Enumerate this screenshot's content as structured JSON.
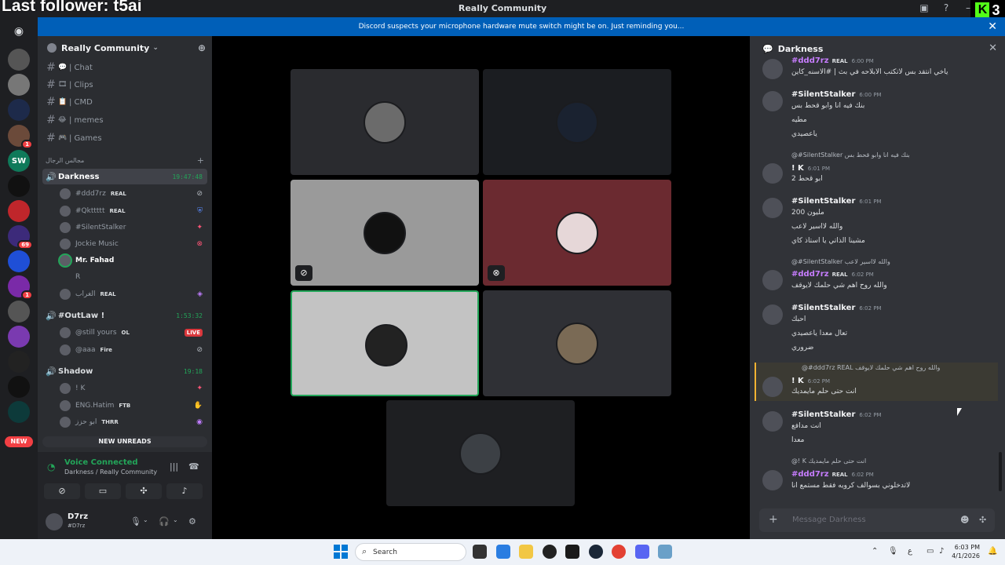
{
  "overlay": {
    "text": "Last follower: t5ai"
  },
  "window": {
    "title": "Really Community",
    "kick_count": "3"
  },
  "notice": {
    "text": "Discord suspects your microphone hardware mute switch might be on. Just reminding you..."
  },
  "server_rail": {
    "badges": [
      "1",
      "69",
      "1"
    ],
    "new_label": "NEW"
  },
  "server": {
    "name": "Really Community"
  },
  "text_channels": [
    {
      "emoji": "💬",
      "name": "| Chat"
    },
    {
      "emoji": "🎞",
      "name": "| Clips"
    },
    {
      "emoji": "📋",
      "name": "| CMD"
    },
    {
      "emoji": "😂",
      "name": "| memes"
    },
    {
      "emoji": "🎮",
      "name": "| Games"
    }
  ],
  "category": {
    "label": "مجالس الرجال"
  },
  "voice_channels": [
    {
      "name": "Darkness",
      "timer": "19:47:48",
      "users": [
        {
          "name": "#ddd7rz",
          "tag": "REAL"
        },
        {
          "name": "#Qkttttt",
          "tag": "REAL"
        },
        {
          "name": "#SilentStalker",
          "tag": ""
        },
        {
          "name": "Jockie Music",
          "tag": ""
        },
        {
          "name": "Mr. Fahad",
          "tag": ""
        },
        {
          "name": "R",
          "tag": ""
        },
        {
          "name": "الغراب",
          "tag": "REAL"
        }
      ]
    },
    {
      "name": "#OutLaw !",
      "timer": "1:53:32",
      "users": [
        {
          "name": "@still yours",
          "tag": "OL",
          "live": "LIVE"
        },
        {
          "name": "@aaa",
          "tag": "Fire"
        }
      ]
    },
    {
      "name": "Shadow",
      "timer": "19:18",
      "users": [
        {
          "name": "! K",
          "tag": ""
        },
        {
          "name": "ENG.Hatim",
          "tag": "FTB"
        },
        {
          "name": "ابو حزز",
          "tag": "THRR"
        }
      ]
    }
  ],
  "new_unreads": "NEW UNREADS",
  "voice_panel": {
    "status": "Voice Connected",
    "location": "Darkness / Really Community"
  },
  "user_panel": {
    "name": "D7rz",
    "handle": "#D7rz"
  },
  "chat": {
    "channel": "Darkness",
    "input_placeholder": "Message Darkness",
    "messages": [
      {
        "name": "#ddd7rz",
        "tag": "REAL",
        "time": "6:00 PM",
        "lines": [
          "ياخي انتقد بس لاتكتب الابلاحه في بث | #الاسنه_كاين"
        ]
      },
      {
        "name": "#SilentStalker",
        "tag": "",
        "time": "6:00 PM",
        "lines": [
          "بنك فيه انا وابو قحط بس",
          "مطيه",
          "ياعصيدي"
        ]
      },
      {
        "reply": "@#SilentStalker بنك فيه انا وابو قحط بس",
        "name": "! K",
        "tag": "",
        "time": "6:01 PM",
        "lines": [
          "ابو قحط 2"
        ]
      },
      {
        "name": "#SilentStalker",
        "tag": "",
        "time": "6:01 PM",
        "lines": [
          "200 مليون",
          "والله لااسير لاعب",
          "مشينا الذاتي يا استاذ كاي"
        ]
      },
      {
        "reply": "@#SilentStalker والله لااسير لاعب",
        "name": "#ddd7rz",
        "tag": "REAL",
        "time": "6:02 PM",
        "lines": [
          "والله روح اهم شي حلمك لايوقف"
        ]
      },
      {
        "name": "#SilentStalker",
        "tag": "",
        "time": "6:02 PM",
        "lines": [
          "احبك",
          "تعال معدا ياعصيدي",
          "ضروري"
        ]
      },
      {
        "reply": "@#ddd7rz REAL والله روح اهم شي حلمك لايوقف",
        "name": "! K",
        "tag": "",
        "time": "6:02 PM",
        "lines": [
          "انت حتى حلم مايمديك"
        ]
      },
      {
        "name": "#SilentStalker",
        "tag": "",
        "time": "6:02 PM",
        "lines": [
          "انت مدافع",
          "معدا"
        ]
      },
      {
        "reply": "@! K انت حتى حلم مايمديك",
        "name": "#ddd7rz",
        "tag": "REAL",
        "time": "6:02 PM",
        "lines": [
          "لاتدخلوني بسوالف كرويه فقط مستمع انا"
        ]
      }
    ]
  },
  "taskbar": {
    "search": "Search",
    "time": "6:03 PM",
    "date": "4/1/2026",
    "lang": "ع"
  },
  "colors": {
    "accent": "#23a559",
    "notice": "#005fb8",
    "live": "#da373c",
    "mention_highlight": "#f0b232",
    "purple_name": "#c77dff"
  }
}
